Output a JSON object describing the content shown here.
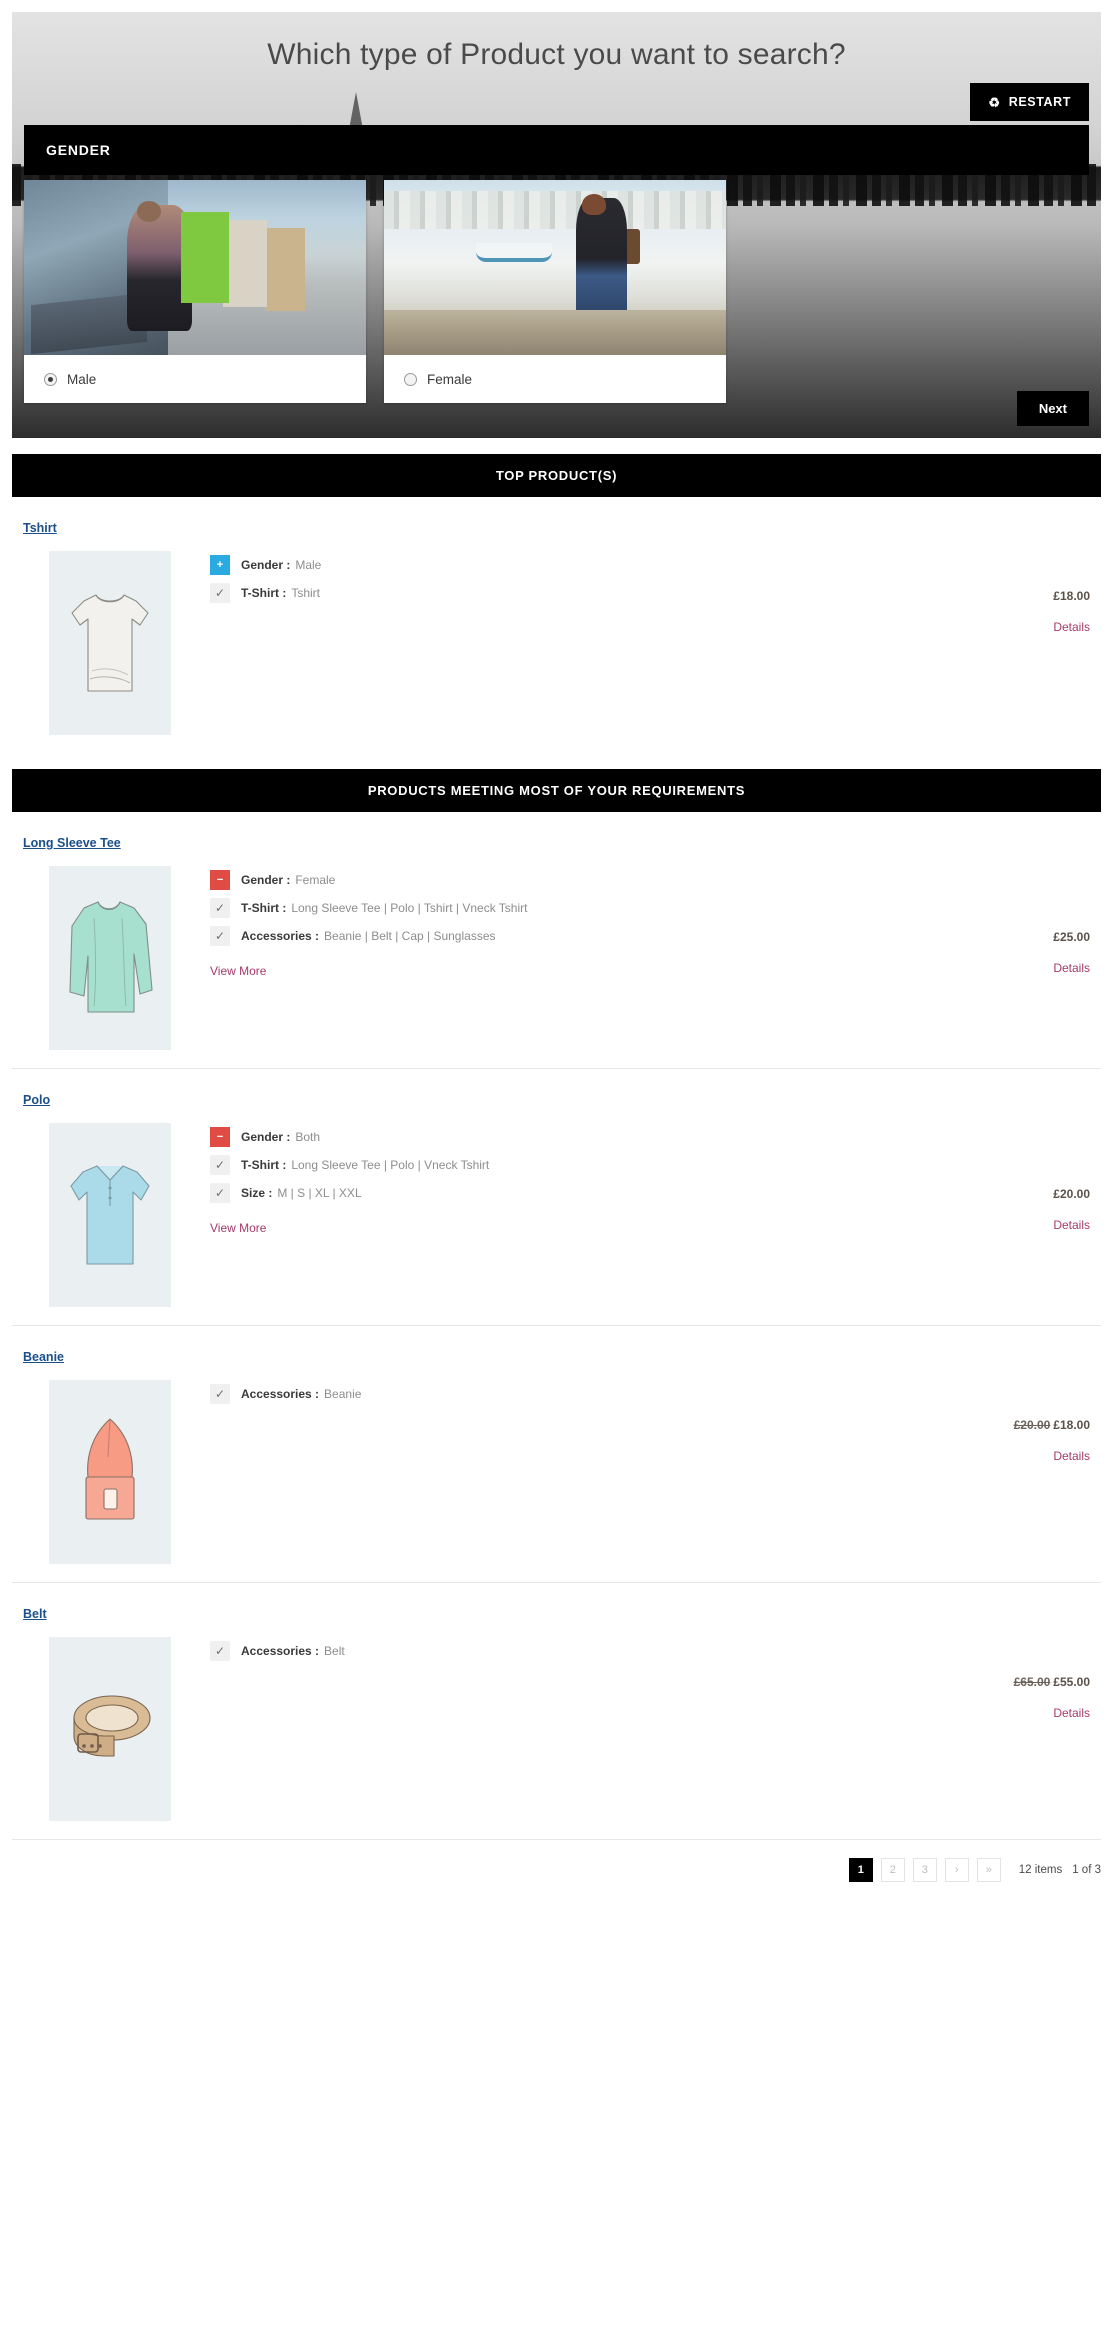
{
  "hero": {
    "title": "Which type of Product you want to search?",
    "restart_label": "RESTART",
    "restart_icon": "refresh-icon",
    "step_title": "GENDER",
    "next_label": "Next",
    "choices": [
      {
        "label": "Male",
        "selected": true,
        "image": "man-sitting-at-bus-stop-photo"
      },
      {
        "label": "Female",
        "selected": false,
        "image": "woman-sitting-by-river-photo"
      }
    ]
  },
  "sections": [
    {
      "title": "TOP PRODUCT(S)"
    },
    {
      "title": "PRODUCTS MEETING MOST OF YOUR REQUIREMENTS"
    }
  ],
  "top_products": [
    {
      "name": "Tshirt",
      "thumb": "tshirt-illustration",
      "attrs": [
        {
          "badge": "plus",
          "key": "Gender :",
          "value": "Male"
        },
        {
          "badge": "check",
          "key": "T-Shirt :",
          "value": "Tshirt"
        }
      ],
      "view_more": null,
      "price": "£18.00",
      "old_price": null,
      "details_label": "Details"
    }
  ],
  "matching_products": [
    {
      "name": "Long Sleeve Tee",
      "thumb": "long-sleeve-tee-illustration",
      "attrs": [
        {
          "badge": "minus",
          "key": "Gender :",
          "value": "Female"
        },
        {
          "badge": "check",
          "key": "T-Shirt :",
          "value": "Long Sleeve Tee | Polo | Tshirt | Vneck Tshirt"
        },
        {
          "badge": "check",
          "key": "Accessories :",
          "value": "Beanie | Belt | Cap | Sunglasses"
        }
      ],
      "view_more": "View More",
      "price": "£25.00",
      "old_price": null,
      "details_label": "Details"
    },
    {
      "name": "Polo",
      "thumb": "polo-shirt-illustration",
      "attrs": [
        {
          "badge": "minus",
          "key": "Gender :",
          "value": "Both"
        },
        {
          "badge": "check",
          "key": "T-Shirt :",
          "value": "Long Sleeve Tee | Polo | Vneck Tshirt"
        },
        {
          "badge": "check",
          "key": "Size :",
          "value": "M | S | XL | XXL"
        }
      ],
      "view_more": "View More",
      "price": "£20.00",
      "old_price": null,
      "details_label": "Details"
    },
    {
      "name": "Beanie",
      "thumb": "beanie-hat-illustration",
      "attrs": [
        {
          "badge": "check",
          "key": "Accessories :",
          "value": "Beanie"
        }
      ],
      "view_more": null,
      "price": "£18.00",
      "old_price": "£20.00",
      "details_label": "Details"
    },
    {
      "name": "Belt",
      "thumb": "leather-belt-illustration",
      "attrs": [
        {
          "badge": "check",
          "key": "Accessories :",
          "value": "Belt"
        }
      ],
      "view_more": null,
      "price": "£55.00",
      "old_price": "£65.00",
      "details_label": "Details"
    }
  ],
  "pagination": {
    "pages": [
      "1",
      "2",
      "3"
    ],
    "active": "1",
    "next_label": "›",
    "last_label": "»",
    "items_label": "12 items",
    "page_of_label": "1 of 3"
  },
  "colors": {
    "accent_blue": "#29abe2",
    "accent_red": "#e04b43",
    "link_blue": "#1a4f8a",
    "link_magenta": "#a33b6b",
    "bar_black": "#000000"
  }
}
